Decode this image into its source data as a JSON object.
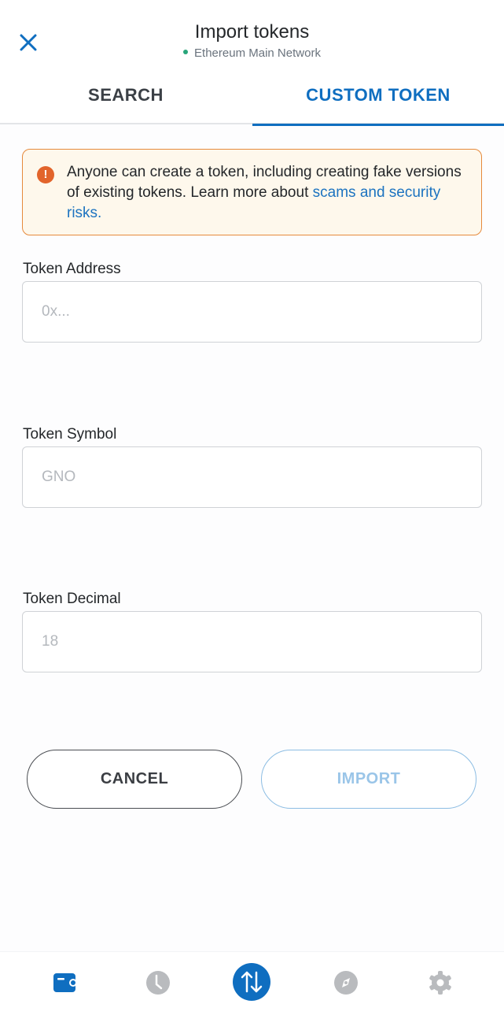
{
  "header": {
    "title": "Import tokens",
    "network": "Ethereum Main Network",
    "network_status_color": "#28a57a",
    "close_icon": "close-icon"
  },
  "tabs": [
    {
      "label": "SEARCH",
      "active": false
    },
    {
      "label": "CUSTOM TOKEN",
      "active": true
    }
  ],
  "warning": {
    "icon": "exclamation-circle-icon",
    "text": "Anyone can create a token, including creating fake versions of existing tokens. Learn more about ",
    "link_text": "scams and security risks."
  },
  "form": {
    "address": {
      "label": "Token Address",
      "placeholder": "0x...",
      "value": ""
    },
    "symbol": {
      "label": "Token Symbol",
      "placeholder": "GNO",
      "value": ""
    },
    "decimal": {
      "label": "Token Decimal",
      "placeholder": "18",
      "value": ""
    }
  },
  "buttons": {
    "cancel": "CANCEL",
    "import": "IMPORT",
    "import_enabled": false
  },
  "bottom_nav": [
    {
      "name": "wallet",
      "icon": "wallet-icon",
      "active": true
    },
    {
      "name": "activity",
      "icon": "clock-icon",
      "active": false
    },
    {
      "name": "swap",
      "icon": "swap-arrows-icon",
      "active": false
    },
    {
      "name": "browser",
      "icon": "compass-icon",
      "active": false
    },
    {
      "name": "settings",
      "icon": "gear-icon",
      "active": false
    }
  ],
  "colors": {
    "accent": "#0f6ec0",
    "warning_border": "#e68a3c",
    "warning_bg": "#fef8ec",
    "warning_icon": "#e2642b"
  }
}
